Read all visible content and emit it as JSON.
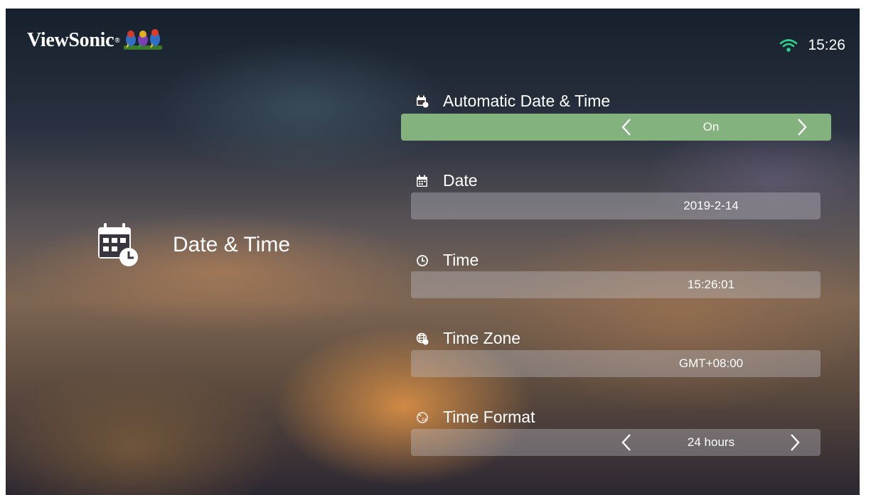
{
  "brand": {
    "name": "ViewSonic",
    "reg": "®"
  },
  "status": {
    "clock": "15:26",
    "wifi_icon": "wifi-icon"
  },
  "page": {
    "title": "Date & Time",
    "icon": "calendar-clock-icon"
  },
  "settings": [
    {
      "label": "Automatic Date & Time",
      "value": "On",
      "icon": "calendar-auto-icon",
      "selected": true,
      "has_arrows": true
    },
    {
      "label": "Date",
      "value": "2019-2-14",
      "icon": "calendar-icon",
      "selected": false,
      "has_arrows": false
    },
    {
      "label": "Time",
      "value": "15:26:01",
      "icon": "clock-icon",
      "selected": false,
      "has_arrows": false
    },
    {
      "label": "Time Zone",
      "value": "GMT+08:00",
      "icon": "globe-clock-icon",
      "selected": false,
      "has_arrows": false
    },
    {
      "label": "Time Format",
      "value": "24 hours",
      "icon": "clock-24-icon",
      "selected": false,
      "has_arrows": true
    }
  ],
  "colors": {
    "selected_bar": "#84b27f"
  }
}
